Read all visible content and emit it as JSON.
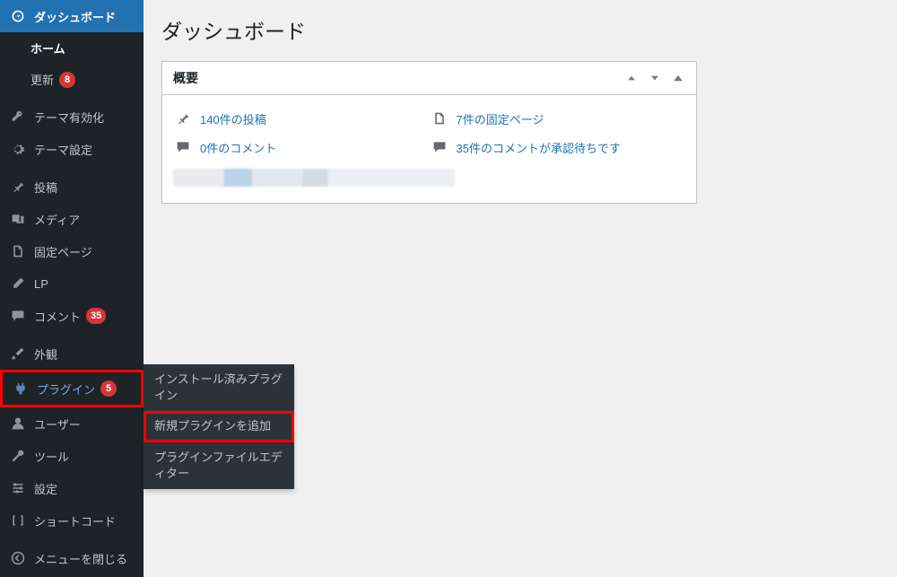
{
  "page": {
    "title": "ダッシュボード"
  },
  "sidebar": {
    "dashboard": "ダッシュボード",
    "home": "ホーム",
    "updates": "更新",
    "updates_count": "8",
    "theme_enable": "テーマ有効化",
    "theme_settings": "テーマ設定",
    "posts": "投稿",
    "media": "メディア",
    "pages": "固定ページ",
    "lp": "LP",
    "comments": "コメント",
    "comments_count": "35",
    "appearance": "外観",
    "plugins": "プラグイン",
    "plugins_count": "5",
    "users": "ユーザー",
    "tools": "ツール",
    "settings": "設定",
    "shortcode": "ショートコード",
    "collapse": "メニューを閉じる"
  },
  "flyout": {
    "installed": "インストール済みプラグイン",
    "add_new": "新規プラグインを追加",
    "editor": "プラグインファイルエディター"
  },
  "panel": {
    "title": "概要",
    "posts": "140件の投稿",
    "pages": "7件の固定ページ",
    "comments": "0件のコメント",
    "pending": "35件のコメントが承認待ちです"
  }
}
